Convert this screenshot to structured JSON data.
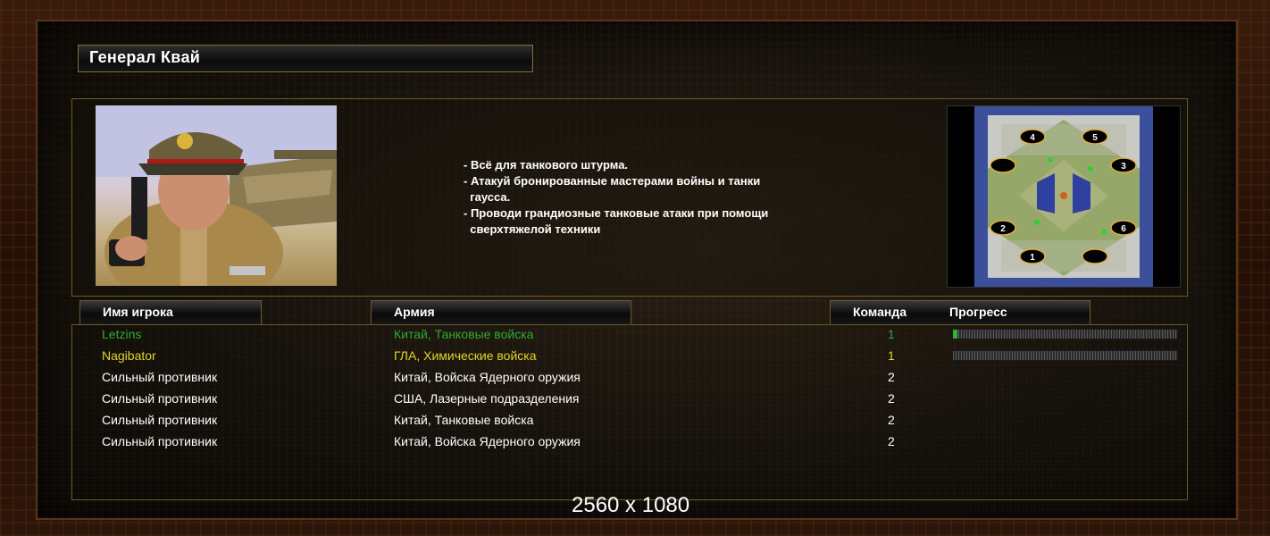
{
  "general_title": "Генерал Квай",
  "bullets": [
    "- Всё для танкового штурма.",
    "- Атакуй бронированные мастерами войны и танки",
    "  гаусса.",
    "- Проводи грандиозные танковые атаки при помощи",
    "  сверхтяжелой техники"
  ],
  "columns": {
    "player": "Имя игрока",
    "army": "Армия",
    "team": "Команда",
    "progress": "Прогресс"
  },
  "players": [
    {
      "name": "Letzins",
      "army": "Китай, Танковые войска",
      "team": "1",
      "color": "#2eab2e",
      "progress": 0.02,
      "show_progress": true
    },
    {
      "name": "Nagibator",
      "army": "ГЛА, Химические войска",
      "team": "1",
      "color": "#e2d42a",
      "progress": 0,
      "show_progress": true
    },
    {
      "name": "Сильный противник",
      "army": "Китай, Войска Ядерного оружия",
      "team": "2",
      "color": "#ffffff",
      "show_progress": false
    },
    {
      "name": "Сильный противник",
      "army": "США, Лазерные подразделения",
      "team": "2",
      "color": "#ffffff",
      "show_progress": false
    },
    {
      "name": "Сильный противник",
      "army": "Китай, Танковые войска",
      "team": "2",
      "color": "#ffffff",
      "show_progress": false
    },
    {
      "name": "Сильный противник",
      "army": "Китай, Войска Ядерного оружия",
      "team": "2",
      "color": "#ffffff",
      "show_progress": false
    }
  ],
  "minimap_slots": [
    "4",
    "5",
    "3",
    "2",
    "6",
    "1"
  ],
  "resolution_label": "2560 x 1080"
}
